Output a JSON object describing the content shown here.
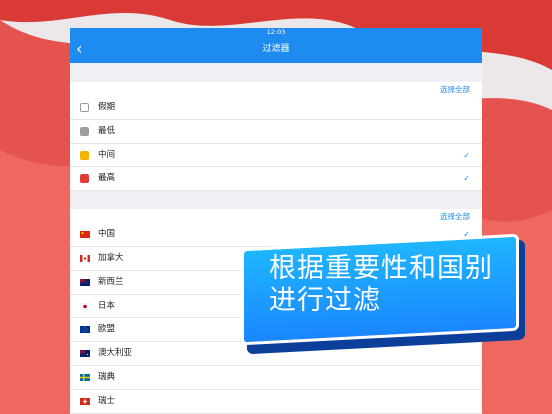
{
  "status_time": "12:03",
  "nav": {
    "back_glyph": "‹",
    "title": "过滤器"
  },
  "importance": {
    "select_all": "选择全部",
    "items": [
      {
        "label": "假期",
        "checked": false,
        "color": "#ffffff"
      },
      {
        "label": "最低",
        "checked": false,
        "color": "#9e9e9e"
      },
      {
        "label": "中间",
        "checked": true,
        "color": "#f4b400"
      },
      {
        "label": "最高",
        "checked": true,
        "color": "#e53935"
      }
    ]
  },
  "countries": {
    "select_all": "选择全部",
    "items": [
      {
        "label": "中国",
        "checked": true,
        "flag": "cn-flag-icon"
      },
      {
        "label": "加拿大",
        "checked": false,
        "flag": "ca-flag-icon"
      },
      {
        "label": "新西兰",
        "checked": false,
        "flag": "nz-flag-icon"
      },
      {
        "label": "日本",
        "checked": false,
        "flag": "jp-flag-icon"
      },
      {
        "label": "欧盟",
        "checked": false,
        "flag": "eu-flag-icon"
      },
      {
        "label": "澳大利亚",
        "checked": false,
        "flag": "au-flag-icon"
      },
      {
        "label": "瑞典",
        "checked": false,
        "flag": "se-flag-icon"
      },
      {
        "label": "瑞士",
        "checked": false,
        "flag": "ch-flag-icon"
      }
    ]
  },
  "check_glyph": "✓",
  "banner": {
    "line1": "根据重要性和国别",
    "line2": "进行过滤"
  },
  "colors": {
    "accent": "#1d8bf0",
    "background_red": "#e53935"
  }
}
